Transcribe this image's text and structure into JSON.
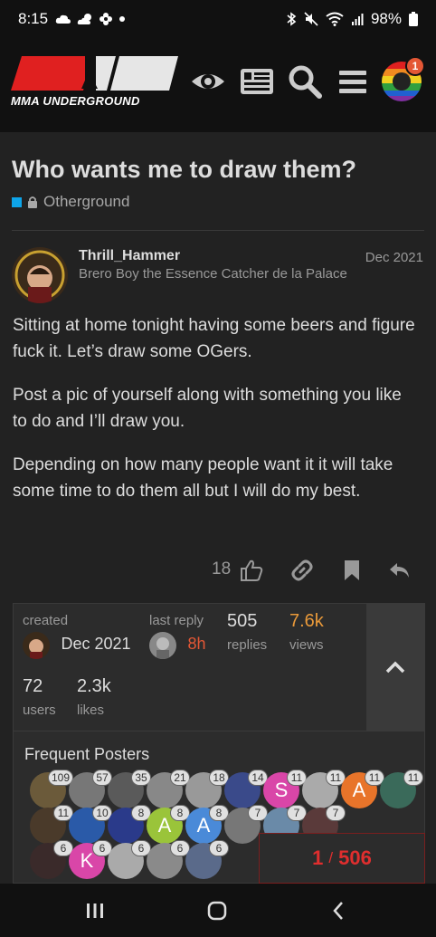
{
  "status_bar": {
    "time": "8:15",
    "battery": "98%"
  },
  "header": {
    "logo_text": "MMA UNDERGROUND",
    "notification_count": "1",
    "icons": [
      "eye-icon",
      "news-icon",
      "search-icon",
      "hamburger-icon",
      "avatar"
    ]
  },
  "topic": {
    "title": "Who wants me to draw them?",
    "category": "Otherground",
    "category_color": "#0ea5e9"
  },
  "post": {
    "username": "Thrill_Hammer",
    "user_title": "Brero Boy the Essence Catcher de la Palace",
    "date": "Dec 2021",
    "paragraphs": [
      "Sitting at home tonight having some beers and figure fuck it. Let’s draw some OGers.",
      "Post a pic of yourself along with something you like to do and I’ll draw you.",
      "Depending on how many people want it it will take some time to do them all but I will do my best."
    ],
    "like_count": "18"
  },
  "topic_map": {
    "created_label": "created",
    "created_date": "Dec 2021",
    "last_reply_label": "last reply",
    "last_reply_date": "8h",
    "replies_count": "505",
    "replies_label": "replies",
    "views_count": "7.6k",
    "views_label": "views",
    "users_count": "72",
    "users_label": "users",
    "likes_count": "2.3k",
    "likes_label": "likes",
    "frequent_posters_label": "Frequent Posters",
    "posters": [
      {
        "count": "109",
        "letter": "",
        "color": "#6b5a3a"
      },
      {
        "count": "57",
        "letter": "",
        "color": "#777777"
      },
      {
        "count": "35",
        "letter": "",
        "color": "#5a5a5a"
      },
      {
        "count": "21",
        "letter": "",
        "color": "#888888"
      },
      {
        "count": "18",
        "letter": "",
        "color": "#999999"
      },
      {
        "count": "14",
        "letter": "",
        "color": "#3a4a8a"
      },
      {
        "count": "11",
        "letter": "S",
        "color": "#d946a8"
      },
      {
        "count": "11",
        "letter": "",
        "color": "#aaaaaa"
      },
      {
        "count": "11",
        "letter": "A",
        "color": "#e8742a"
      },
      {
        "count": "11",
        "letter": "",
        "color": "#3a6a5a"
      },
      {
        "count": "11",
        "letter": "",
        "color": "#4a3a2a"
      },
      {
        "count": "10",
        "letter": "",
        "color": "#2a5aa8"
      },
      {
        "count": "8",
        "letter": "",
        "color": "#2a3a8a"
      },
      {
        "count": "8",
        "letter": "A",
        "color": "#9ac43a"
      },
      {
        "count": "8",
        "letter": "A",
        "color": "#4a8ad8"
      },
      {
        "count": "7",
        "letter": "",
        "color": "#777777"
      },
      {
        "count": "7",
        "letter": "",
        "color": "#6a8aa8"
      },
      {
        "count": "7",
        "letter": "",
        "color": "#5a3a3a"
      },
      {
        "count": "6",
        "letter": "",
        "color": "#3a2a2a"
      },
      {
        "count": "6",
        "letter": "K",
        "color": "#d946a8"
      },
      {
        "count": "6",
        "letter": "",
        "color": "#aaaaaa"
      },
      {
        "count": "6",
        "letter": "",
        "color": "#8a8a8a"
      },
      {
        "count": "6",
        "letter": "",
        "color": "#5a6a8a"
      }
    ]
  },
  "progress": {
    "current": "1",
    "total": "506"
  }
}
